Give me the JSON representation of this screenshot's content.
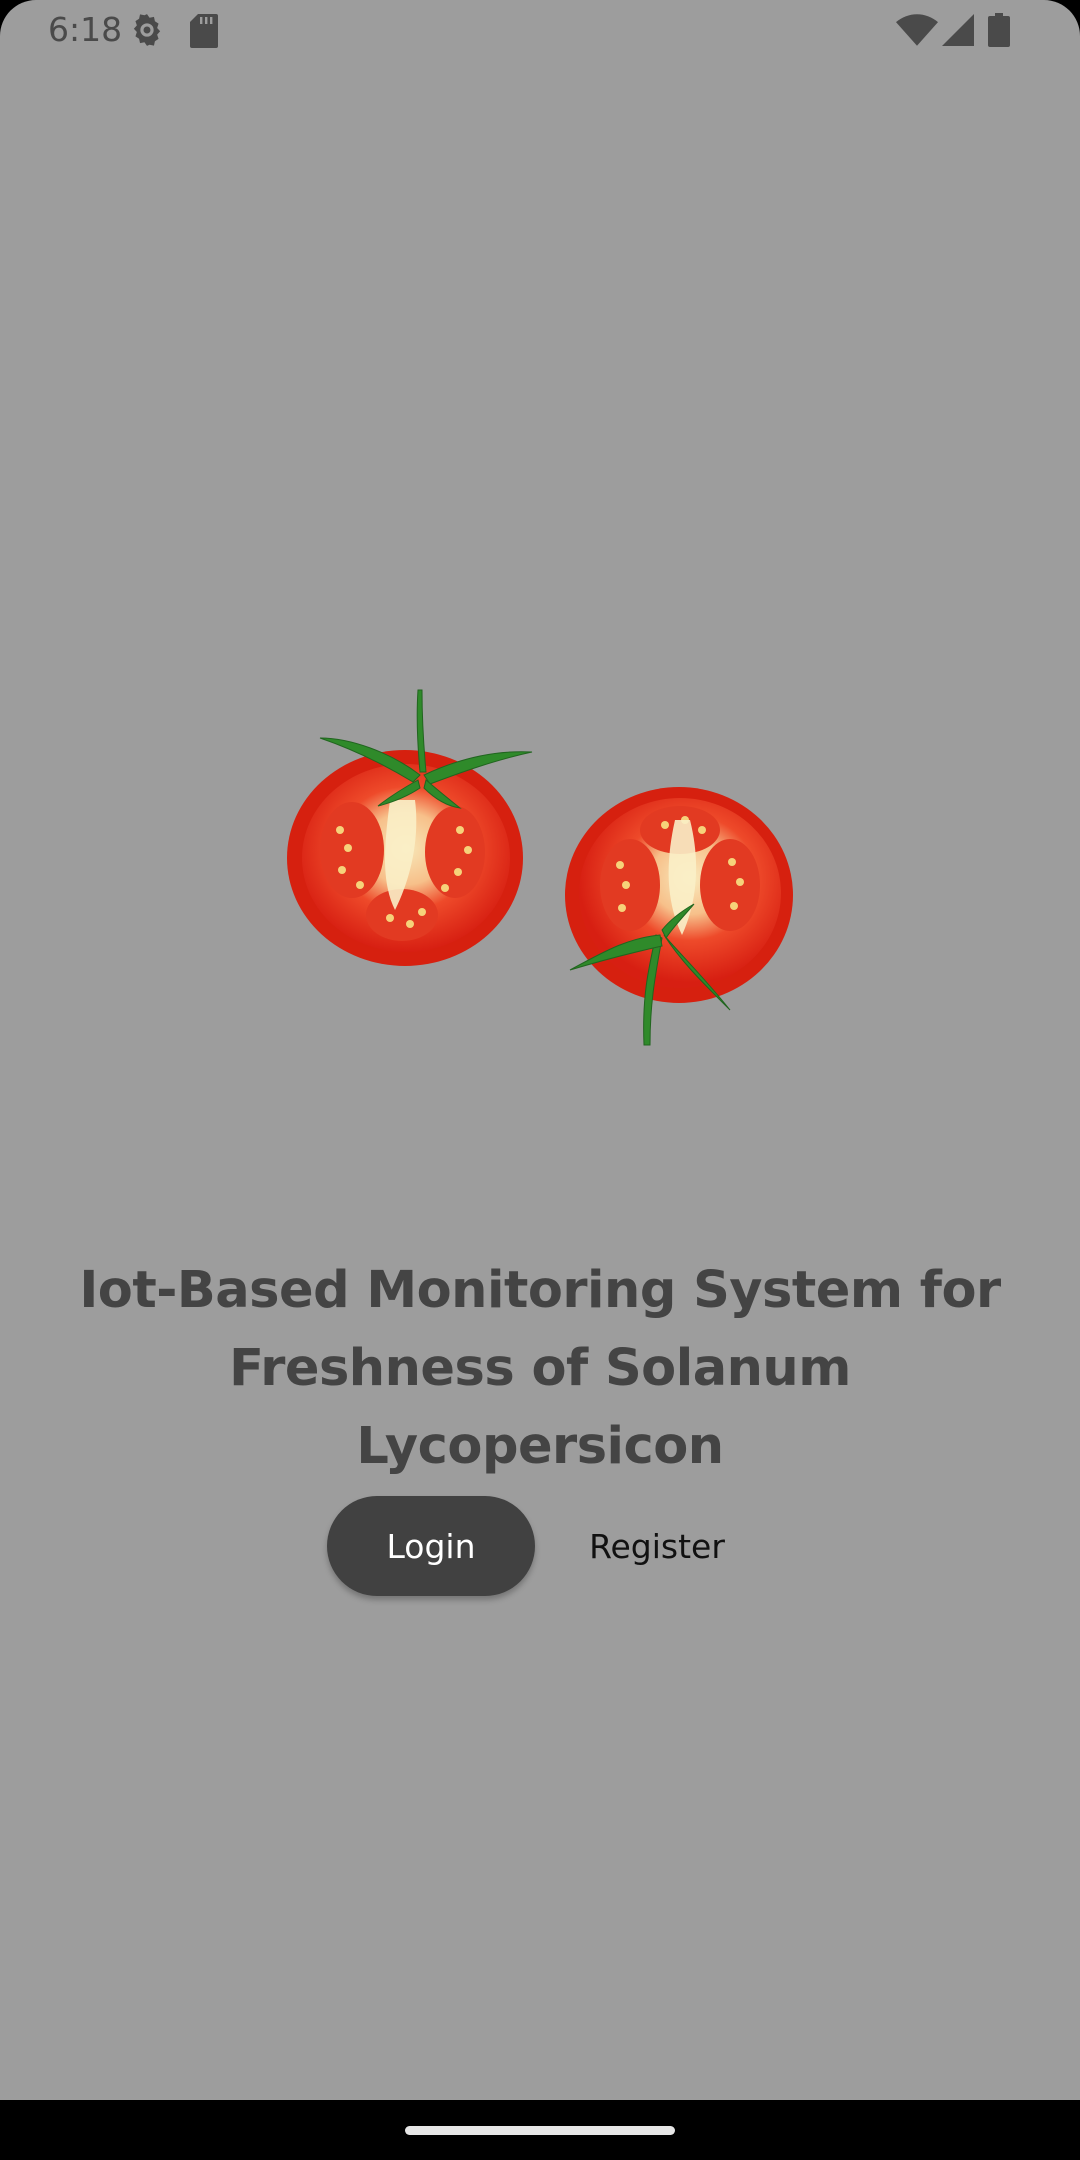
{
  "status_bar": {
    "time": "6:18",
    "icons": [
      "gear-icon",
      "sd-card-icon",
      "wifi-icon",
      "signal-icon",
      "battery-icon"
    ]
  },
  "hero": {
    "image": "two-tomato-halves"
  },
  "title": {
    "line1": "Iot-Based Monitoring System for",
    "line2": "Freshness of Solanum Lycopersicon"
  },
  "actions": {
    "login_label": "Login",
    "register_label": "Register"
  },
  "colors": {
    "background": "#9d9d9d",
    "primary_button": "#414141",
    "title_text": "#444444",
    "tomato_red": "#e12a1a",
    "stem_green": "#2f8a2a"
  }
}
